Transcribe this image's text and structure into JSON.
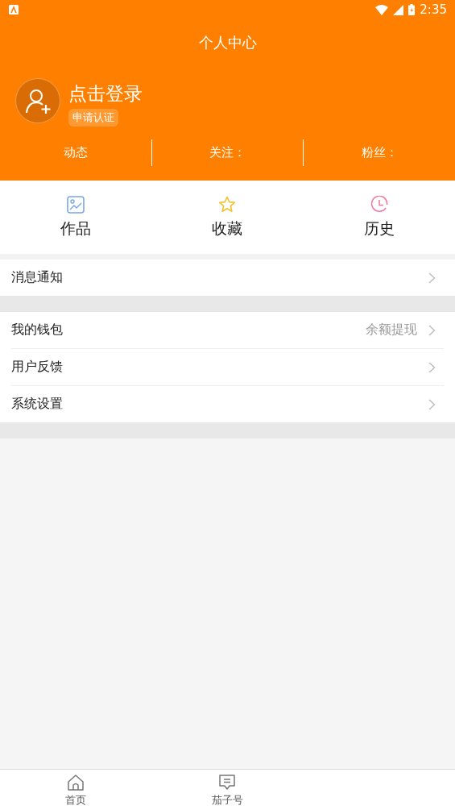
{
  "status_bar": {
    "time": "2:35"
  },
  "header": {
    "title": "个人中心",
    "login_text": "点击登录",
    "badge": "申请认证"
  },
  "stats": [
    {
      "label": "动态"
    },
    {
      "label": "关注："
    },
    {
      "label": "粉丝："
    }
  ],
  "shortcuts": [
    {
      "label": "作品",
      "kind": "image"
    },
    {
      "label": "收藏",
      "kind": "star"
    },
    {
      "label": "历史",
      "kind": "clock"
    }
  ],
  "menu_groups": [
    {
      "items": [
        {
          "label": "消息通知"
        }
      ]
    },
    {
      "items": [
        {
          "label": "我的钱包",
          "value": "余额提现"
        },
        {
          "label": "用户反馈"
        },
        {
          "label": "系统设置"
        }
      ]
    }
  ],
  "bottom_nav": [
    {
      "label": "首页",
      "kind": "home",
      "selected": false
    },
    {
      "label": "茄子号",
      "kind": "message",
      "selected": false
    }
  ]
}
